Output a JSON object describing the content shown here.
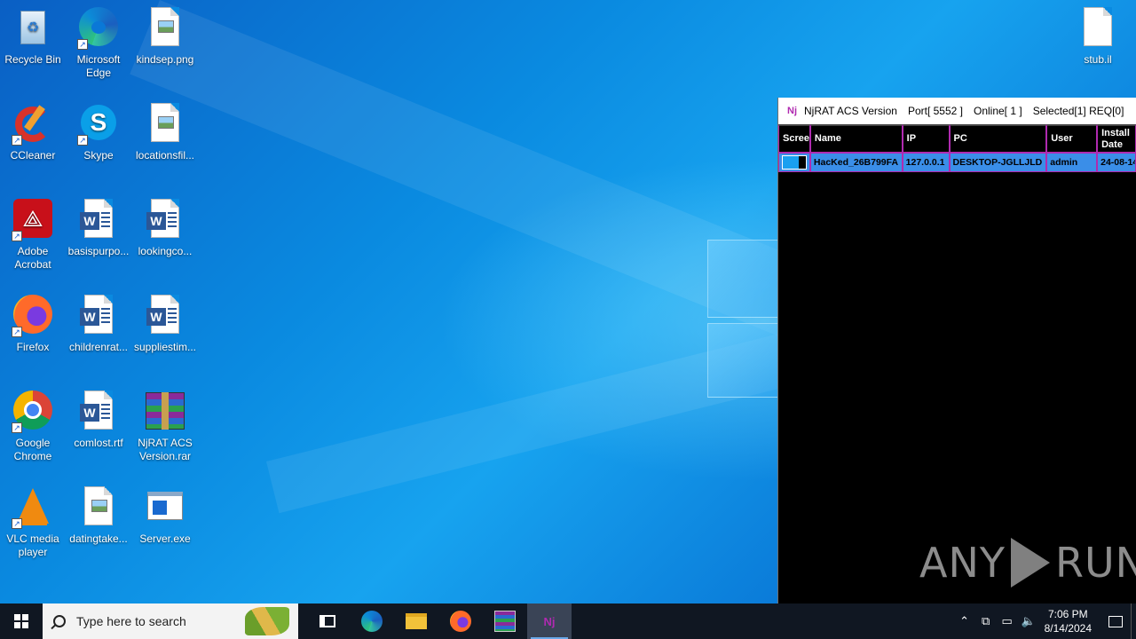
{
  "desktop": {
    "icons": [
      {
        "label": "Recycle Bin"
      },
      {
        "label": "Microsoft Edge"
      },
      {
        "label": "kindsep.png"
      },
      {
        "label": "CCleaner"
      },
      {
        "label": "Skype"
      },
      {
        "label": "locationsfil..."
      },
      {
        "label": "Adobe Acrobat"
      },
      {
        "label": "basispurpo..."
      },
      {
        "label": "lookingco..."
      },
      {
        "label": "Firefox"
      },
      {
        "label": "childrenrat..."
      },
      {
        "label": "suppliestim..."
      },
      {
        "label": "Google Chrome"
      },
      {
        "label": "comlost.rtf"
      },
      {
        "label": "NjRAT ACS Version.rar"
      },
      {
        "label": "VLC media player"
      },
      {
        "label": "datingtake..."
      },
      {
        "label": "Server.exe"
      },
      {
        "label": "stub.il"
      }
    ]
  },
  "rat_window": {
    "badge": "Nj",
    "title": "NjRAT ACS Version",
    "port": "Port[ 5552 ]",
    "online": "Online[ 1 ]",
    "selected": "Selected[1] REQ[0]",
    "columns": [
      "Screen",
      "Name",
      "IP",
      "PC",
      "User",
      "Install Date"
    ],
    "rows": [
      {
        "name": "HacKed_26B799FA",
        "ip": "127.0.0.1",
        "pc": "DESKTOP-JGLLJLD",
        "user": "admin",
        "install_date": "24-08-14"
      }
    ]
  },
  "watermark": {
    "left": "ANY",
    "right": "RUN"
  },
  "taskbar": {
    "search_placeholder": "Type here to search",
    "apps": [
      "task-view",
      "edge",
      "file-explorer",
      "firefox",
      "winrar",
      "njrat"
    ],
    "active_app": "njrat",
    "clock_time": "7:06 PM",
    "clock_date": "8/14/2024"
  },
  "colors": {
    "rat_accent": "#b02ab0",
    "row_selected": "#3a8ee8",
    "taskbar": "#101722"
  }
}
